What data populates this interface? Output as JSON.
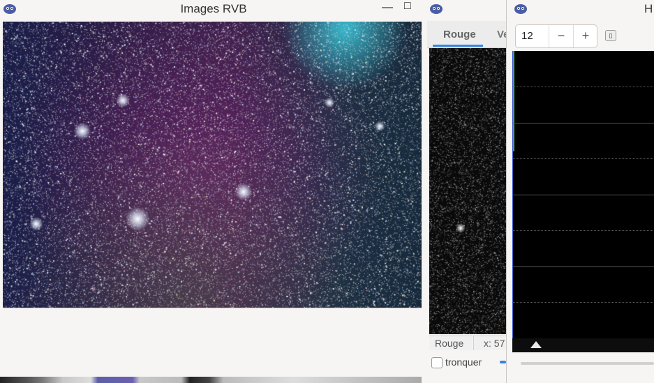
{
  "windows": {
    "rgb": {
      "title": "Images RVB",
      "minimize": "—",
      "maximize": "□"
    },
    "red": {
      "tabs": [
        {
          "label": "Rouge"
        },
        {
          "label": "Ve"
        }
      ],
      "status_channel": "Rouge",
      "status_coord": "x: 57",
      "checkbox_label": "tronquer"
    },
    "hist": {
      "title": "H",
      "spinner_value": "12",
      "minus": "−",
      "plus": "+"
    }
  },
  "colors": {
    "accent": "#3584e4",
    "plot_border": "#2c53c0",
    "plot_marker": "#2fbf3a"
  },
  "icons": {
    "app": "gimp-like-app-icon"
  }
}
